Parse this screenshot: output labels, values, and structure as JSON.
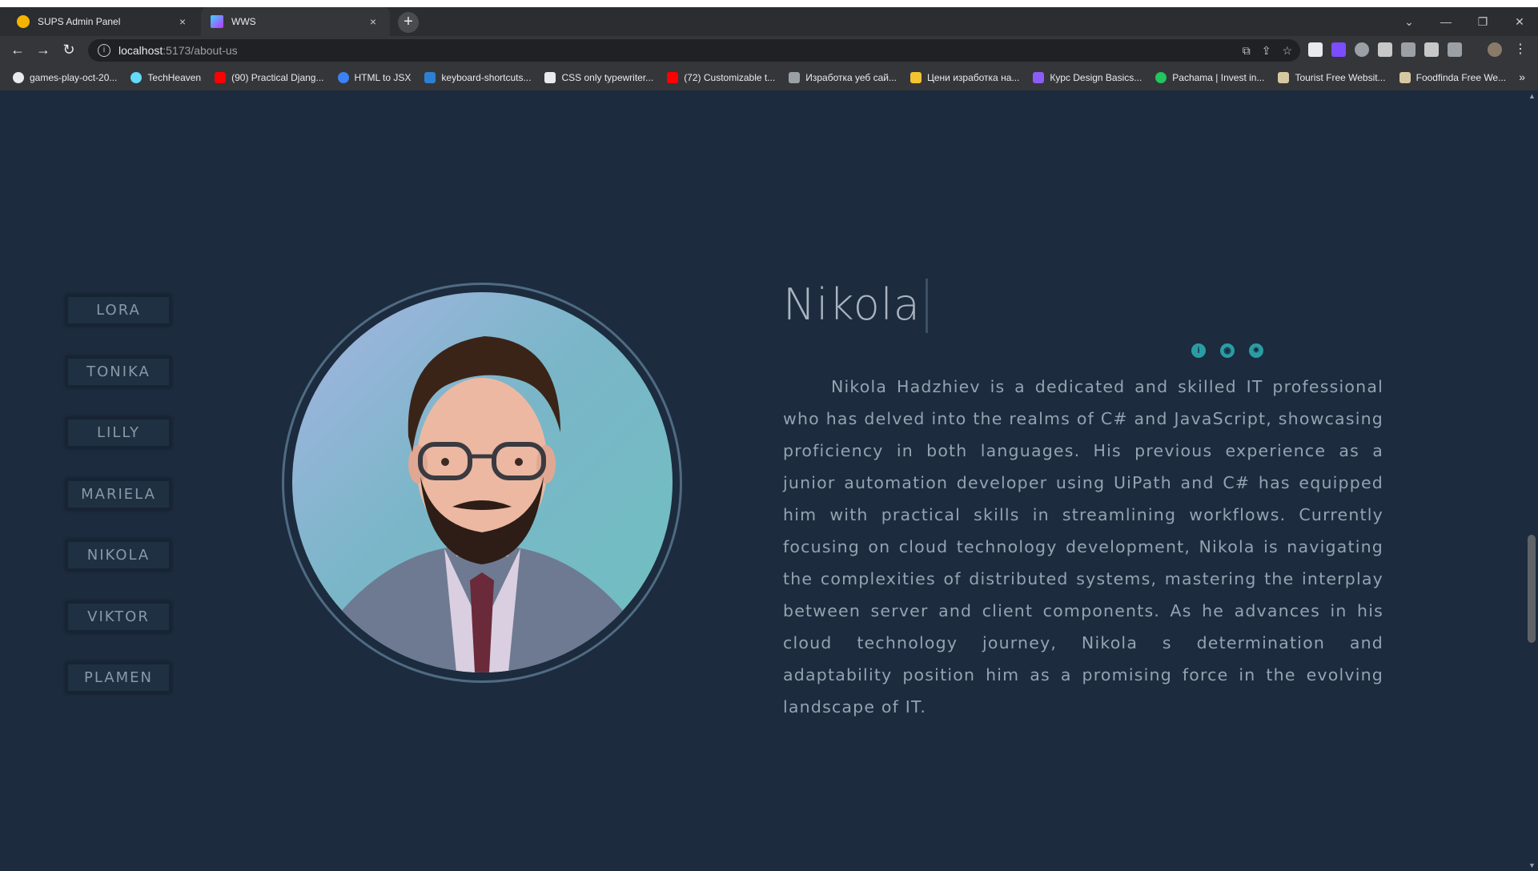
{
  "browser": {
    "tabs": [
      {
        "title": "SUPS Admin Panel",
        "close": "×"
      },
      {
        "title": "WWS",
        "close": "×"
      }
    ],
    "new_tab": "+",
    "window_controls": {
      "dropdown": "⌄",
      "minimize": "—",
      "restore": "❐",
      "close": "✕"
    },
    "address": {
      "host": "localhost",
      "path": ":5173/about-us",
      "info": "i"
    },
    "nav": {
      "back": "←",
      "forward": "→",
      "reload": "↻"
    },
    "bookmarks": [
      {
        "label": "games-play-oct-20...",
        "color": "#e8eaed"
      },
      {
        "label": "TechHeaven",
        "color": "#61dafb"
      },
      {
        "label": "(90) Practical Djang...",
        "color": "#ff0000"
      },
      {
        "label": "HTML to JSX",
        "color": "#3b82f6"
      },
      {
        "label": "keyboard-shortcuts...",
        "color": "#2d7fd3"
      },
      {
        "label": "CSS only typewriter...",
        "color": "#e8eaed"
      },
      {
        "label": "(72) Customizable t...",
        "color": "#ff0000"
      },
      {
        "label": "Изработка уеб сай...",
        "color": "#9aa0a6"
      },
      {
        "label": "Цени изработка на...",
        "color": "#f4c430"
      },
      {
        "label": "Курс Design Basics...",
        "color": "#8b5cf6"
      },
      {
        "label": "Pachama | Invest in...",
        "color": "#22c55e"
      },
      {
        "label": "Tourist Free Websit...",
        "color": "#d6c9a0"
      },
      {
        "label": "Foodfinda Free We...",
        "color": "#d6c9a0"
      }
    ],
    "bookmarks_more": "»"
  },
  "sidebar": {
    "members": [
      "LORA",
      "TONIKA",
      "LILLY",
      "MARIELA",
      "NIKOLA",
      "VIKTOR",
      "PLAMEN"
    ]
  },
  "profile": {
    "name": "Nikola",
    "social_icons": [
      "info-icon",
      "github-icon",
      "badge-icon"
    ],
    "bio": "Nikola Hadzhiev is a dedicated and skilled IT professional who has delved into the realms of C# and JavaScript, showcasing proficiency in both languages. His previous experience as a junior automation developer using UiPath and C# has equipped him with practical skills in streamlining workflows. Currently focusing on cloud technology development, Nikola is navigating the complexities of distributed systems, mastering the interplay between server and client components. As he advances in his cloud technology journey, Nikola s determination and adaptability position him as a promising force in the evolving landscape of IT."
  },
  "colors": {
    "page_bg": "#1c2b3e",
    "accent": "#2a9da3",
    "text": "#95a2b1"
  }
}
